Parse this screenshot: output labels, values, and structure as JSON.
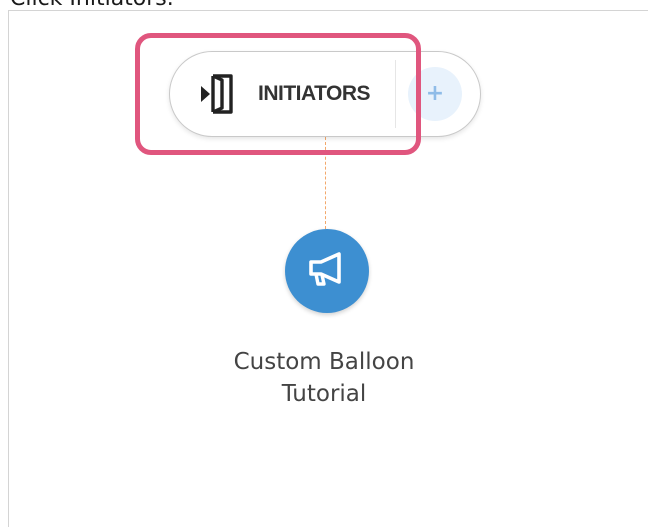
{
  "instruction": "Click Initiators.",
  "initiators_bar": {
    "label": "INITIATORS",
    "add_symbol": "+",
    "icon": "enter-door-icon"
  },
  "connector": {
    "color": "#f3a86b"
  },
  "nodes": [
    {
      "icon": "megaphone-icon",
      "label": "Custom Balloon Tutorial",
      "color": "#3d8fd1"
    }
  ],
  "highlight": {
    "color": "#e0567e"
  }
}
